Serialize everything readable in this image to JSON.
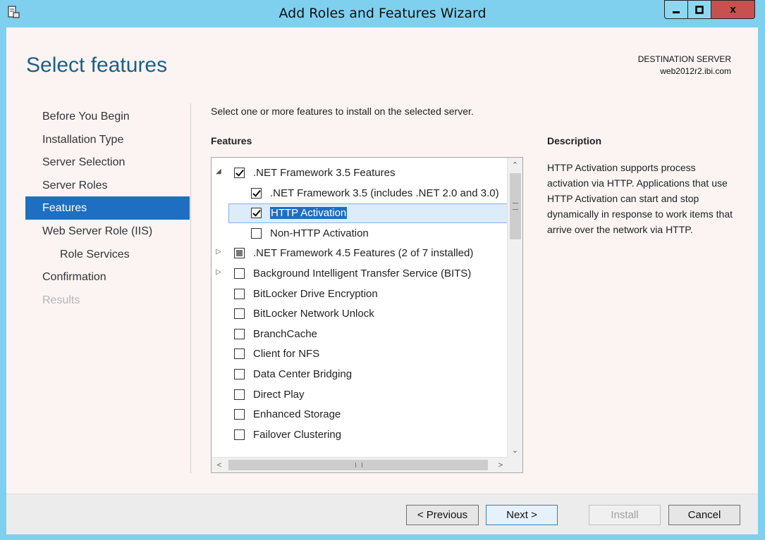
{
  "window": {
    "title": "Add Roles and Features Wizard",
    "close_glyph": "x"
  },
  "page": {
    "title": "Select features",
    "destination_label": "DESTINATION SERVER",
    "destination_server": "web2012r2.ibi.com",
    "instruction": "Select one or more features to install on the selected server."
  },
  "nav": [
    {
      "label": "Before You Begin",
      "state": "normal"
    },
    {
      "label": "Installation Type",
      "state": "normal"
    },
    {
      "label": "Server Selection",
      "state": "normal"
    },
    {
      "label": "Server Roles",
      "state": "normal"
    },
    {
      "label": "Features",
      "state": "active"
    },
    {
      "label": "Web Server Role (IIS)",
      "state": "normal"
    },
    {
      "label": "Role Services",
      "state": "sub"
    },
    {
      "label": "Confirmation",
      "state": "normal"
    },
    {
      "label": "Results",
      "state": "disabled"
    }
  ],
  "features": {
    "heading": "Features",
    "items": [
      {
        "label": ".NET Framework 3.5 Features",
        "level": 0,
        "expander": "expanded",
        "check": "checked"
      },
      {
        "label": ".NET Framework 3.5 (includes .NET 2.0 and 3.0)",
        "level": 1,
        "expander": "none",
        "check": "checked"
      },
      {
        "label": "HTTP Activation",
        "level": 1,
        "expander": "none",
        "check": "checked",
        "selected": true
      },
      {
        "label": "Non-HTTP Activation",
        "level": 1,
        "expander": "none",
        "check": "unchecked"
      },
      {
        "label": ".NET Framework 4.5 Features (2 of 7 installed)",
        "level": 0,
        "expander": "collapsed",
        "check": "partial"
      },
      {
        "label": "Background Intelligent Transfer Service (BITS)",
        "level": 0,
        "expander": "collapsed",
        "check": "unchecked"
      },
      {
        "label": "BitLocker Drive Encryption",
        "level": 0,
        "expander": "none",
        "check": "unchecked"
      },
      {
        "label": "BitLocker Network Unlock",
        "level": 0,
        "expander": "none",
        "check": "unchecked"
      },
      {
        "label": "BranchCache",
        "level": 0,
        "expander": "none",
        "check": "unchecked"
      },
      {
        "label": "Client for NFS",
        "level": 0,
        "expander": "none",
        "check": "unchecked"
      },
      {
        "label": "Data Center Bridging",
        "level": 0,
        "expander": "none",
        "check": "unchecked"
      },
      {
        "label": "Direct Play",
        "level": 0,
        "expander": "none",
        "check": "unchecked"
      },
      {
        "label": "Enhanced Storage",
        "level": 0,
        "expander": "none",
        "check": "unchecked"
      },
      {
        "label": "Failover Clustering",
        "level": 0,
        "expander": "none",
        "check": "unchecked"
      }
    ]
  },
  "description": {
    "heading": "Description",
    "text": "HTTP Activation supports process activation via HTTP. Applications that use HTTP Activation can start and stop dynamically in response to work items that arrive over the network via HTTP."
  },
  "buttons": {
    "previous": "< Previous",
    "next": "Next >",
    "install": "Install",
    "cancel": "Cancel"
  },
  "colors": {
    "frame": "#7fd0ef",
    "accent": "#1e6fc1",
    "title": "#1f5e84",
    "close": "#c75050"
  }
}
